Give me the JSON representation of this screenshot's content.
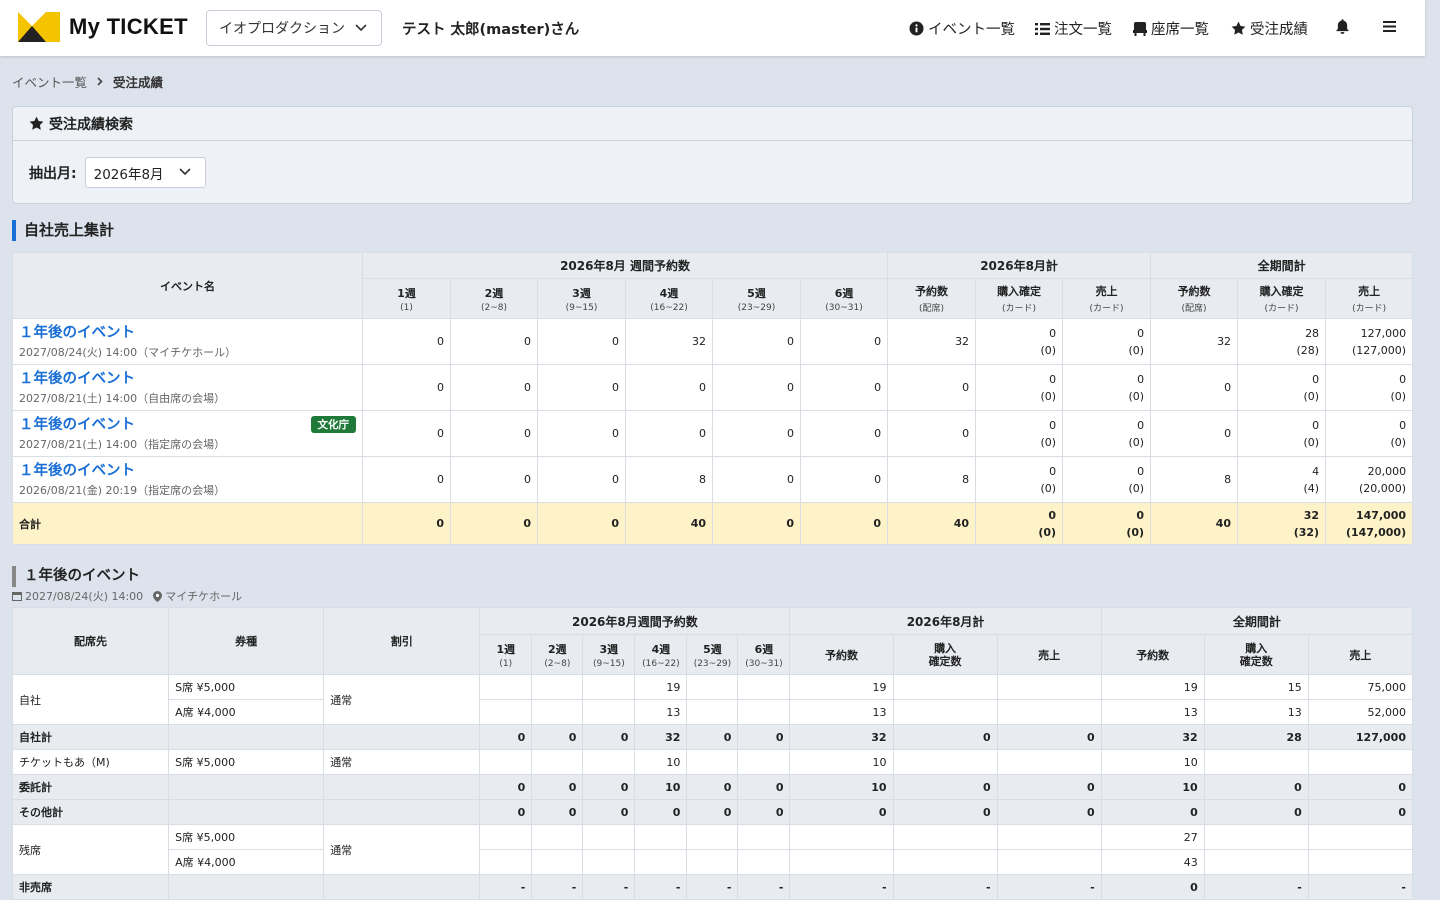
{
  "header": {
    "logo_text": "My TICKET",
    "org_select": "イオプロダクション",
    "user_name": "テスト 太郎(master)さん",
    "nav": [
      {
        "label": "イベント一覧",
        "icon": "info-icon"
      },
      {
        "label": "注文一覧",
        "icon": "list-icon"
      },
      {
        "label": "座席一覧",
        "icon": "seat-icon"
      },
      {
        "label": "受注成績",
        "icon": "star-icon"
      }
    ]
  },
  "breadcrumb": {
    "parent": "イベント一覧",
    "current": "受注成績"
  },
  "search": {
    "title": "受注成績検索",
    "month_label": "抽出月:",
    "month_value": "2026年8月"
  },
  "summary": {
    "title": "自社売上集計",
    "group_weekly": "2026年8月 週間予約数",
    "group_month": "2026年8月計",
    "group_all": "全期間計",
    "col_event": "イベント名",
    "weeks": [
      {
        "label": "1週",
        "range": "(1)"
      },
      {
        "label": "2週",
        "range": "(2~8)"
      },
      {
        "label": "3週",
        "range": "(9~15)"
      },
      {
        "label": "4週",
        "range": "(16~22)"
      },
      {
        "label": "5週",
        "range": "(23~29)"
      },
      {
        "label": "6週",
        "range": "(30~31)"
      }
    ],
    "col_reserve": "予約数",
    "col_reserve_sub": "(配席)",
    "col_purchase": "購入確定",
    "col_purchase_sub": "(カード)",
    "col_sales": "売上",
    "col_sales_sub": "(カード)",
    "rows": [
      {
        "name": "１年後のイベント",
        "sub": "2027/08/24(火) 14:00（マイチケホール）",
        "badge": "",
        "weeks": [
          "0",
          "0",
          "0",
          "32",
          "0",
          "0"
        ],
        "m_res": "32",
        "m_pur": "0",
        "m_pur2": "(0)",
        "m_sal": "0",
        "m_sal2": "(0)",
        "a_res": "32",
        "a_pur": "28",
        "a_pur2": "(28)",
        "a_sal": "127,000",
        "a_sal2": "(127,000)"
      },
      {
        "name": "１年後のイベント",
        "sub": "2027/08/21(土) 14:00（自由席の会場）",
        "badge": "",
        "weeks": [
          "0",
          "0",
          "0",
          "0",
          "0",
          "0"
        ],
        "m_res": "0",
        "m_pur": "0",
        "m_pur2": "(0)",
        "m_sal": "0",
        "m_sal2": "(0)",
        "a_res": "0",
        "a_pur": "0",
        "a_pur2": "(0)",
        "a_sal": "0",
        "a_sal2": "(0)"
      },
      {
        "name": "１年後のイベント",
        "sub": "2027/08/21(土) 14:00（指定席の会場）",
        "badge": "文化庁",
        "weeks": [
          "0",
          "0",
          "0",
          "0",
          "0",
          "0"
        ],
        "m_res": "0",
        "m_pur": "0",
        "m_pur2": "(0)",
        "m_sal": "0",
        "m_sal2": "(0)",
        "a_res": "0",
        "a_pur": "0",
        "a_pur2": "(0)",
        "a_sal": "0",
        "a_sal2": "(0)"
      },
      {
        "name": "１年後のイベント",
        "sub": "2026/08/21(金) 20:19（指定席の会場）",
        "badge": "",
        "weeks": [
          "0",
          "0",
          "0",
          "8",
          "0",
          "0"
        ],
        "m_res": "8",
        "m_pur": "0",
        "m_pur2": "(0)",
        "m_sal": "0",
        "m_sal2": "(0)",
        "a_res": "8",
        "a_pur": "4",
        "a_pur2": "(4)",
        "a_sal": "20,000",
        "a_sal2": "(20,000)"
      }
    ],
    "total": {
      "label": "合計",
      "weeks": [
        "0",
        "0",
        "0",
        "40",
        "0",
        "0"
      ],
      "m_res": "40",
      "m_pur": "0",
      "m_pur2": "(0)",
      "m_sal": "0",
      "m_sal2": "(0)",
      "a_res": "40",
      "a_pur": "32",
      "a_pur2": "(32)",
      "a_sal": "147,000",
      "a_sal2": "(147,000)"
    }
  },
  "event_detail": {
    "title": "１年後のイベント",
    "datetime": "2027/08/24(火) 14:00",
    "venue": "マイチケホール",
    "group_weekly": "2026年8月週間予約数",
    "group_month": "2026年8月計",
    "group_all": "全期間計",
    "col_dest": "配席先",
    "col_ticket": "券種",
    "col_discount": "割引",
    "col_reserve": "予約数",
    "col_confirm": "購入\n確定数",
    "col_sales": "売上",
    "rows": [
      {
        "type": "data",
        "dest": "自社",
        "ticket": "S席 ¥5,000",
        "discount": "通常",
        "weeks": [
          "",
          "",
          "",
          "19",
          "",
          ""
        ],
        "m": [
          "19",
          "",
          ""
        ],
        "a": [
          "19",
          "15",
          "75,000"
        ]
      },
      {
        "type": "data",
        "dest": "",
        "ticket": "A席 ¥4,000",
        "discount": "",
        "weeks": [
          "",
          "",
          "",
          "13",
          "",
          ""
        ],
        "m": [
          "13",
          "",
          ""
        ],
        "a": [
          "13",
          "13",
          "52,000"
        ]
      },
      {
        "type": "sub",
        "dest": "自社計",
        "weeks": [
          "0",
          "0",
          "0",
          "32",
          "0",
          "0"
        ],
        "m": [
          "32",
          "0",
          "0"
        ],
        "a": [
          "32",
          "28",
          "127,000"
        ]
      },
      {
        "type": "data",
        "dest": "チケットもあ（M)",
        "ticket": "S席 ¥5,000",
        "discount": "通常",
        "weeks": [
          "",
          "",
          "",
          "10",
          "",
          ""
        ],
        "m": [
          "10",
          "",
          ""
        ],
        "a": [
          "10",
          "",
          ""
        ]
      },
      {
        "type": "sub",
        "dest": "委託計",
        "weeks": [
          "0",
          "0",
          "0",
          "10",
          "0",
          "0"
        ],
        "m": [
          "10",
          "0",
          "0"
        ],
        "a": [
          "10",
          "0",
          "0"
        ]
      },
      {
        "type": "sub",
        "dest": "その他計",
        "weeks": [
          "0",
          "0",
          "0",
          "0",
          "0",
          "0"
        ],
        "m": [
          "0",
          "0",
          "0"
        ],
        "a": [
          "0",
          "0",
          "0"
        ]
      },
      {
        "type": "data",
        "dest": "残席",
        "ticket": "S席 ¥5,000",
        "discount": "通常",
        "weeks": [
          "",
          "",
          "",
          "",
          "",
          ""
        ],
        "m": [
          "",
          "",
          ""
        ],
        "a": [
          "27",
          "",
          ""
        ]
      },
      {
        "type": "data",
        "dest": "",
        "ticket": "A席 ¥4,000",
        "discount": "",
        "weeks": [
          "",
          "",
          "",
          "",
          "",
          ""
        ],
        "m": [
          "",
          "",
          ""
        ],
        "a": [
          "43",
          "",
          ""
        ]
      },
      {
        "type": "sub",
        "dest": "非売席",
        "weeks": [
          "-",
          "-",
          "-",
          "-",
          "-",
          "-"
        ],
        "m": [
          "-",
          "-",
          "-"
        ],
        "a": [
          "0",
          "-",
          "-"
        ]
      }
    ]
  },
  "colors": {
    "accent": "#1a6fd6",
    "logo_yellow": "#f5c400",
    "badge_green": "#1f7a3a",
    "total_bg": "#fdf2c8"
  }
}
